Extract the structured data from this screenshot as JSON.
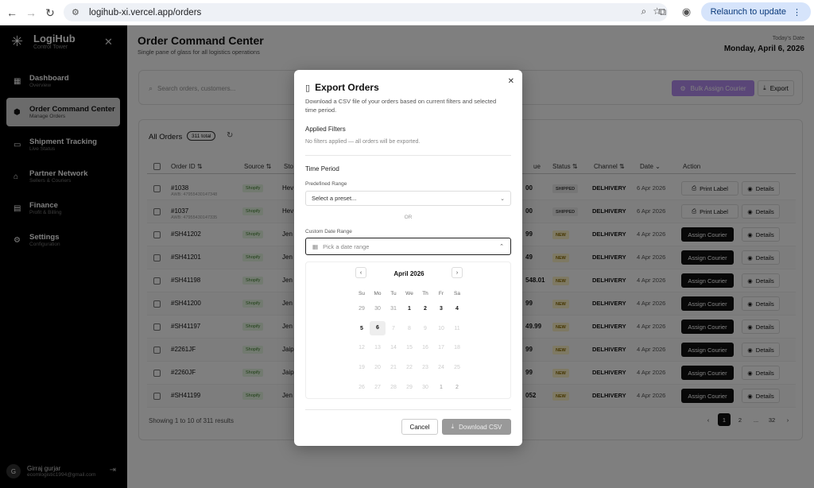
{
  "browser": {
    "url": "logihub-xi.vercel.app/orders",
    "relaunch_label": "Relaunch to update"
  },
  "sidebar": {
    "brand": "LogiHub",
    "brand_sub": "Control Tower",
    "items": [
      {
        "label": "Dashboard",
        "sub": "Overview",
        "icon": "grid-icon"
      },
      {
        "label": "Order Command Center",
        "sub": "Manage Orders",
        "icon": "package-icon"
      },
      {
        "label": "Shipment Tracking",
        "sub": "Live Status",
        "icon": "truck-icon"
      },
      {
        "label": "Partner Network",
        "sub": "Sellers & Couriers",
        "icon": "users-icon"
      },
      {
        "label": "Finance",
        "sub": "Profit & Billing",
        "icon": "wallet-icon"
      },
      {
        "label": "Settings",
        "sub": "Configuration",
        "icon": "gear-icon"
      }
    ],
    "user": {
      "initial": "G",
      "name": "Girraj gurjar",
      "email": "ecomlogistic1994@gmail.com"
    }
  },
  "header": {
    "title": "Order Command Center",
    "subtitle": "Single pane of glass for all logistics operations",
    "date_label": "Today's Date",
    "date_value": "Monday, April 6, 2026"
  },
  "toolbar": {
    "search_placeholder": "Search orders, customers...",
    "bulk_label": "Bulk Assign Courier",
    "export_label": "Export"
  },
  "orders": {
    "title": "All Orders",
    "total_badge": "311 total",
    "columns": [
      "Order ID",
      "Source",
      "Sto",
      "ue",
      "Status",
      "Channel",
      "Date",
      "Action"
    ],
    "rows": [
      {
        "id": "#1038",
        "awb": "AWB: 47955430147348",
        "source": "Shopify",
        "store": "Hev",
        "value": "00",
        "status": "SHIPPED",
        "channel": "DELHIVERY",
        "date": "6 Apr 2026",
        "action": "Print Label"
      },
      {
        "id": "#1037",
        "awb": "AWB: 47955430147335",
        "source": "Shopify",
        "store": "Hev",
        "value": "00",
        "status": "SHIPPED",
        "channel": "DELHIVERY",
        "date": "6 Apr 2026",
        "action": "Print Label"
      },
      {
        "id": "#SH41202",
        "awb": "",
        "source": "Shopify",
        "store": "Jen",
        "value": "99",
        "status": "NEW",
        "channel": "DELHIVERY",
        "date": "4 Apr 2026",
        "action": "Assign Courier"
      },
      {
        "id": "#SH41201",
        "awb": "",
        "source": "Shopify",
        "store": "Jen",
        "value": "49",
        "status": "NEW",
        "channel": "DELHIVERY",
        "date": "4 Apr 2026",
        "action": "Assign Courier"
      },
      {
        "id": "#SH41198",
        "awb": "",
        "source": "Shopify",
        "store": "Jen",
        "value": "548.01",
        "status": "NEW",
        "channel": "DELHIVERY",
        "date": "4 Apr 2026",
        "action": "Assign Courier"
      },
      {
        "id": "#SH41200",
        "awb": "",
        "source": "Shopify",
        "store": "Jen",
        "value": "99",
        "status": "NEW",
        "channel": "DELHIVERY",
        "date": "4 Apr 2026",
        "action": "Assign Courier"
      },
      {
        "id": "#SH41197",
        "awb": "",
        "source": "Shopify",
        "store": "Jen",
        "value": "49.99",
        "status": "NEW",
        "channel": "DELHIVERY",
        "date": "4 Apr 2026",
        "action": "Assign Courier"
      },
      {
        "id": "#2261JF",
        "awb": "",
        "source": "Shopify",
        "store": "Jaip",
        "value": "99",
        "status": "NEW",
        "channel": "DELHIVERY",
        "date": "4 Apr 2026",
        "action": "Assign Courier"
      },
      {
        "id": "#2260JF",
        "awb": "",
        "source": "Shopify",
        "store": "Jaip",
        "value": "99",
        "status": "NEW",
        "channel": "DELHIVERY",
        "date": "4 Apr 2026",
        "action": "Assign Courier"
      },
      {
        "id": "#SH41199",
        "awb": "",
        "source": "Shopify",
        "store": "Jen",
        "value": "052",
        "status": "NEW",
        "channel": "DELHIVERY",
        "date": "4 Apr 2026",
        "action": "Assign Courier"
      }
    ],
    "details_label": "Details",
    "pager_text": "Showing 1 to 10 of 311 results",
    "pages": [
      "1",
      "2",
      "...",
      "32"
    ]
  },
  "modal": {
    "title": "Export Orders",
    "description": "Download a CSV file of your orders based on current filters and selected time period.",
    "applied_filters_label": "Applied Filters",
    "applied_filters_note": "No filters applied — all orders will be exported.",
    "time_period_label": "Time Period",
    "predefined_label": "Predefined Range",
    "preset_placeholder": "Select a preset...",
    "or_text": "OR",
    "custom_label": "Custom Date Range",
    "date_placeholder": "Pick a date range",
    "cancel_label": "Cancel",
    "download_label": "Download CSV",
    "calendar": {
      "month": "April 2026",
      "weekdays": [
        "Su",
        "Mo",
        "Tu",
        "We",
        "Th",
        "Fr",
        "Sa"
      ],
      "weeks": [
        [
          "29",
          "30",
          "31",
          "1",
          "2",
          "3",
          "4"
        ],
        [
          "5",
          "6",
          "7",
          "8",
          "9",
          "10",
          "11"
        ],
        [
          "12",
          "13",
          "14",
          "15",
          "16",
          "17",
          "18"
        ],
        [
          "19",
          "20",
          "21",
          "22",
          "23",
          "24",
          "25"
        ],
        [
          "26",
          "27",
          "28",
          "29",
          "30",
          "1",
          "2"
        ]
      ],
      "today": "6"
    }
  },
  "colors": {
    "sidebar_bg": "#000000",
    "accent_purple": "#b48cf0",
    "status_new_bg": "#fdf3c7",
    "source_badge_bg": "#e5f5e0"
  }
}
